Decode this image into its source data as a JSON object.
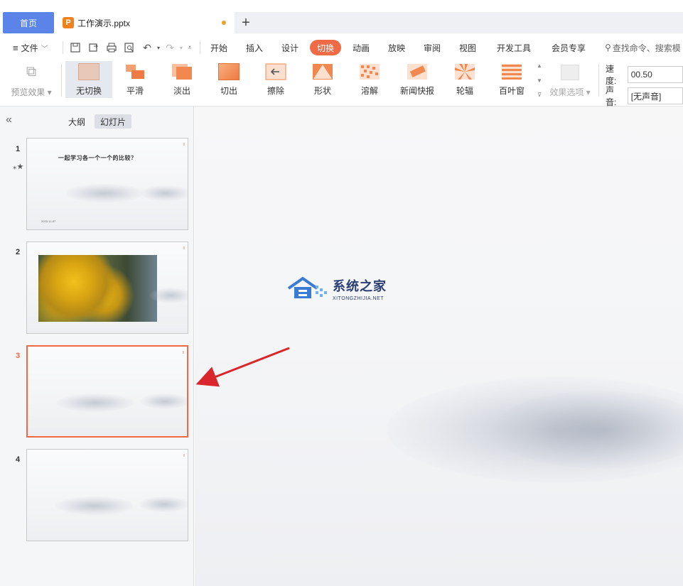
{
  "tabs": {
    "home": "首页",
    "doc_icon": "P",
    "doc_name": "工作演示.pptx",
    "add": "+"
  },
  "menu": {
    "file": "文件",
    "items": [
      "开始",
      "插入",
      "设计",
      "切换",
      "动画",
      "放映",
      "审阅",
      "视图",
      "开发工具",
      "会员专享"
    ],
    "active": "切换",
    "search": "查找命令、搜索模"
  },
  "ribbon": {
    "preview": "预览效果",
    "transitions": [
      "无切换",
      "平滑",
      "淡出",
      "切出",
      "擦除",
      "形状",
      "溶解",
      "新闻快报",
      "轮辐",
      "百叶窗"
    ],
    "selected": "无切换",
    "effect_options": "效果选项",
    "speed_label": "速度:",
    "speed_value": "00.50",
    "sound_label": "声音:",
    "sound_value": "[无声音]"
  },
  "panel": {
    "tab_outline": "大纲",
    "tab_slides": "幻灯片",
    "active_tab": "幻灯片",
    "slides": [
      {
        "number": "1",
        "title": "一起学习各一个一个的比较？",
        "date": "2023-11-07",
        "starred": true
      },
      {
        "number": "2",
        "image": true
      },
      {
        "number": "3",
        "current": true
      },
      {
        "number": "4"
      }
    ]
  },
  "watermark": {
    "name": "系统之家",
    "url": "XITONGZHIJIA.NET"
  },
  "colors": {
    "accent": "#f06a45",
    "home_tab": "#5b84e8",
    "arrow": "#d9262c"
  }
}
